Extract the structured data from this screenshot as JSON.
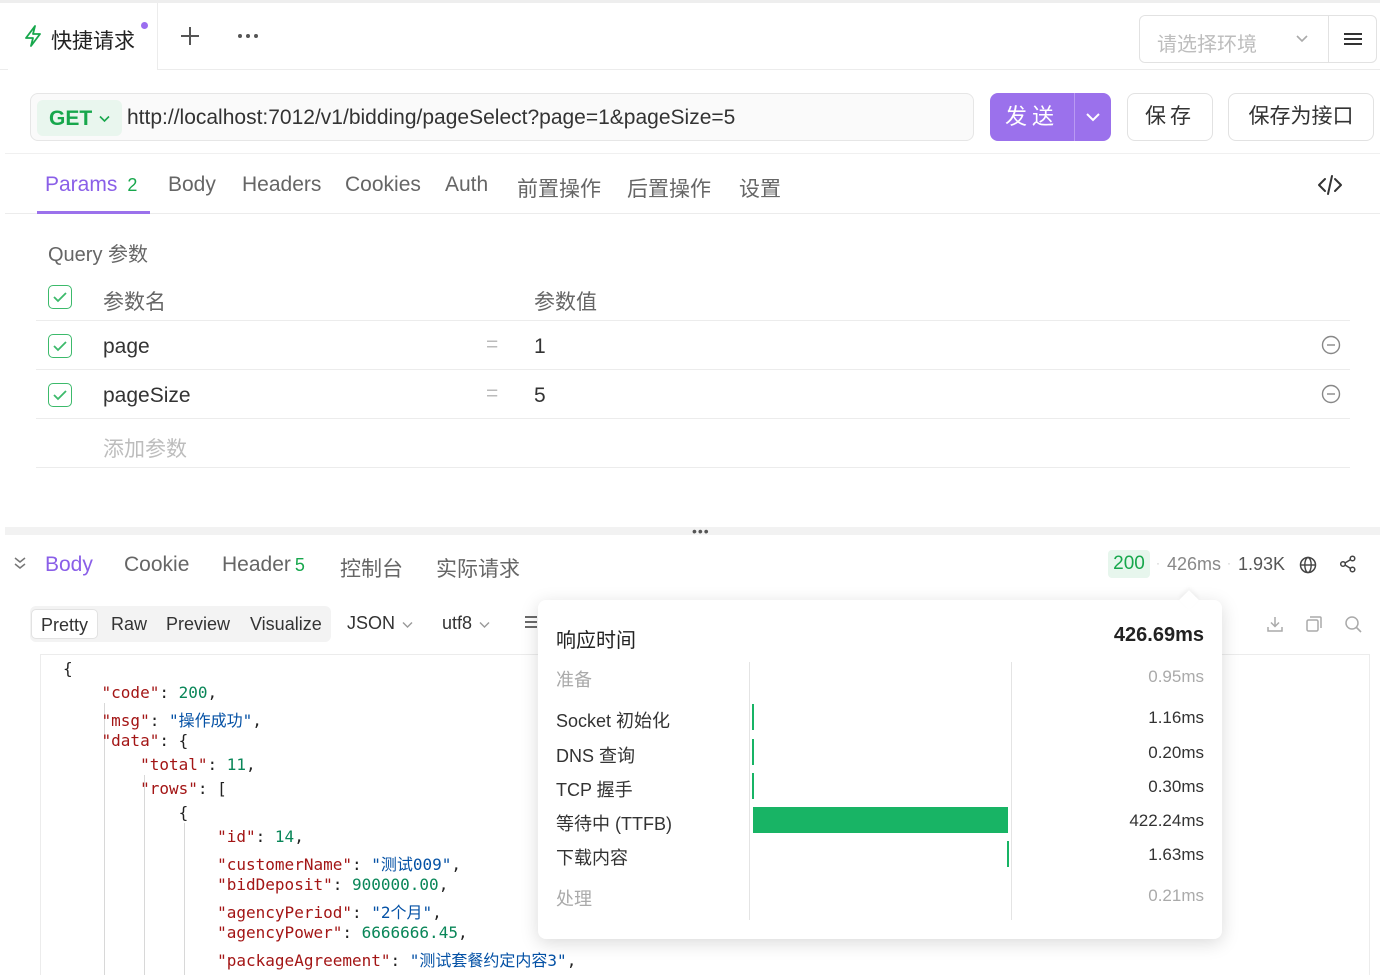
{
  "topbar": {
    "active_tab": "快捷请求",
    "env_placeholder": "请选择环境"
  },
  "request": {
    "method": "GET",
    "url": "http://localhost:7012/v1/bidding/pageSelect?page=1&pageSize=5",
    "send_label": "发送",
    "save_label": "保存",
    "save_as_label": "保存为接口"
  },
  "request_tabs": [
    {
      "label": "Params",
      "badge": "2"
    },
    {
      "label": "Body"
    },
    {
      "label": "Headers"
    },
    {
      "label": "Cookies"
    },
    {
      "label": "Auth"
    },
    {
      "label": "前置操作"
    },
    {
      "label": "后置操作"
    },
    {
      "label": "设置"
    }
  ],
  "params": {
    "section_title": "Query 参数",
    "col_name": "参数名",
    "col_value": "参数值",
    "rows": [
      {
        "name": "page",
        "value": "1"
      },
      {
        "name": "pageSize",
        "value": "5"
      }
    ],
    "add_placeholder": "添加参数",
    "eq_sign": "="
  },
  "response_tabs": [
    {
      "label": "Body"
    },
    {
      "label": "Cookie"
    },
    {
      "label": "Header",
      "badge": "5"
    },
    {
      "label": "控制台"
    },
    {
      "label": "实际请求"
    }
  ],
  "response_meta": {
    "status": "200",
    "time": "426ms",
    "size": "1.93K"
  },
  "format_bar": {
    "modes": [
      "Pretty",
      "Raw",
      "Preview",
      "Visualize"
    ],
    "active_mode": "Pretty",
    "lang": "JSON",
    "encoding": "utf8"
  },
  "code": {
    "l0": "{",
    "code_key": "\"code\"",
    "code_val": "200",
    "msg_key": "\"msg\"",
    "msg_val": "\"操作成功\"",
    "data_key": "\"data\"",
    "total_key": "\"total\"",
    "total_val": "11",
    "rows_key": "\"rows\"",
    "id_key": "\"id\"",
    "id_val": "14",
    "cn_key": "\"customerName\"",
    "cn_val": "\"测试009\"",
    "bd_key": "\"bidDeposit\"",
    "bd_val": "900000.00",
    "ap_key": "\"agencyPeriod\"",
    "ap_val": "\"2个月\"",
    "apw_key": "\"agencyPower\"",
    "apw_val": "6666666.45",
    "pa_key": "\"packageAgreement\"",
    "pa_val": "\"测试套餐约定内容3\""
  },
  "timing": {
    "title": "响应时间",
    "total": "426.69ms",
    "phases": [
      {
        "label": "准备",
        "value": "0.95ms",
        "ms": 0.95
      },
      {
        "label": "Socket 初始化",
        "value": "1.16ms",
        "ms": 1.16
      },
      {
        "label": "DNS 查询",
        "value": "0.20ms",
        "ms": 0.2
      },
      {
        "label": "TCP 握手",
        "value": "0.30ms",
        "ms": 0.3
      },
      {
        "label": "等待中 (TTFB)",
        "value": "422.24ms",
        "ms": 422.24
      },
      {
        "label": "下载内容",
        "value": "1.63ms",
        "ms": 1.63
      },
      {
        "label": "处理",
        "value": "0.21ms",
        "ms": 0.21
      }
    ]
  },
  "colors": {
    "accent": "#9b71ec",
    "success": "#17a74c",
    "bar": "#18b465"
  }
}
